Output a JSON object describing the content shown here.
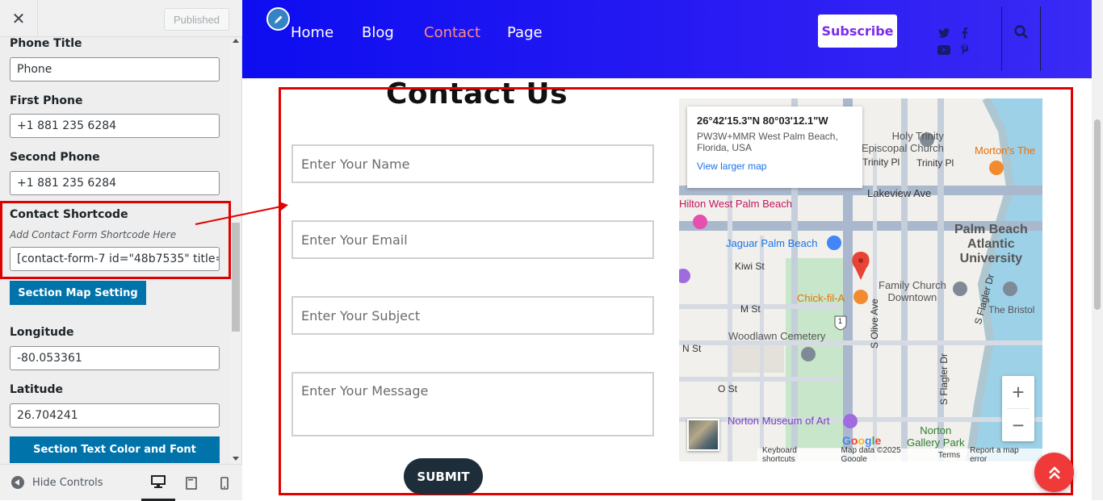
{
  "customizer": {
    "close_icon": "close-icon",
    "published_label": "Published",
    "fields": {
      "phone_title_label": "Phone Title",
      "phone_title_value": "Phone",
      "first_phone_label": "First Phone",
      "first_phone_value": "+1 881 235 6284",
      "second_phone_label": "Second Phone",
      "second_phone_value": "+1 881 235 6284",
      "contact_shortcode_label": "Contact Shortcode",
      "contact_shortcode_desc": "Add Contact Form Shortcode Here",
      "contact_shortcode_value": "[contact-form-7 id=\"48b7535\" title=\"C",
      "section_map_label": "Section Map Setting",
      "longitude_label": "Longitude",
      "longitude_value": "-80.053361",
      "latitude_label": "Latitude",
      "latitude_value": "26.704241",
      "section_text_label": "Section Text Color and Font"
    },
    "footer": {
      "hide_controls_label": "Hide Controls"
    }
  },
  "site": {
    "nav": [
      "Home",
      "Blog",
      "Contact",
      "Page"
    ],
    "subscribe_label": "Subscribe",
    "accent_color": "#ff8a80"
  },
  "contact": {
    "title": "Contact Us",
    "name_placeholder": "Enter Your Name",
    "email_placeholder": "Enter Your Email",
    "subject_placeholder": "Enter Your Subject",
    "message_placeholder": "Enter Your Message",
    "submit_label": "SUBMIT"
  },
  "map": {
    "coordinates": "26°42'15.3\"N 80°03'12.1\"W",
    "address_line1": "PW3W+MMR West Palm Beach,",
    "address_line2": "Florida, USA",
    "larger_map_link": "View larger map",
    "labels": {
      "lakeview": "Lakeview Ave",
      "hilton": "Hilton West Palm Beach",
      "jaguar": "Jaguar Palm Beach",
      "kiwi": "Kiwi St",
      "pba1": "Palm Beach",
      "pba2": "Atlantic",
      "pba3": "University",
      "family1": "Family Church",
      "family2": "Downtown",
      "chick": "Chick-fil-A",
      "mst": "M St",
      "woodlawn": "Woodlawn Cemetery",
      "nst": "N St",
      "ost": "O St",
      "norton_museum": "Norton Museum of Art",
      "norton_gallery1": "Norton",
      "norton_gallery2": "Gallery Park",
      "trinity1": "Holy Trinity",
      "trinity2": "Episcopal Church",
      "trinity_pl": "Trinity Pl",
      "trinity_pl2": "Trinity Pl",
      "mortons": "Morton's The",
      "bristol": "The Bristol",
      "olive": "S Olive Ave",
      "flagler": "S Flagler Dr",
      "flagler2": "S Flagler Dr",
      "route": "1"
    },
    "zoom_in": "+",
    "zoom_out": "−",
    "google": "Google",
    "footer": {
      "shortcuts": "Keyboard shortcuts",
      "data": "Map data ©2025 Google",
      "terms": "Terms",
      "report": "Report a map error"
    }
  }
}
